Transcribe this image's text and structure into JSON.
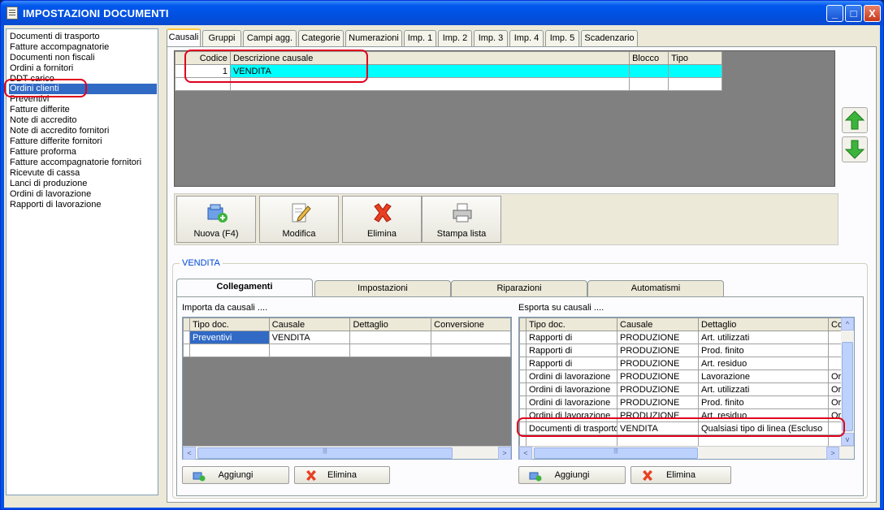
{
  "window": {
    "title": "IMPOSTAZIONI DOCUMENTI",
    "min": "_",
    "max": "□",
    "close": "X"
  },
  "doc_types": [
    "Documenti di trasporto",
    "Fatture accompagnatorie",
    "Documenti non fiscali",
    "Ordini a fornitori",
    "DDT carico",
    "Ordini clienti",
    "Preventivi",
    "Fatture differite",
    "Note di accredito",
    "Note di accredito fornitori",
    "Fatture differite fornitori",
    "Fatture proforma",
    "Fatture accompagnatorie fornitori",
    "Ricevute di cassa",
    "Lanci di produzione",
    "Ordini di lavorazione",
    "Rapporti di lavorazione"
  ],
  "tabs": [
    "Causali",
    "Gruppi",
    "Campi agg.",
    "Categorie",
    "Numerazioni",
    "Imp. 1",
    "Imp. 2",
    "Imp. 3",
    "Imp. 4",
    "Imp. 5",
    "Scadenzario"
  ],
  "causali_grid": {
    "headers": [
      "Codice",
      "Descrizione causale",
      "Blocco",
      "Tipo"
    ],
    "rows": [
      [
        "1",
        "VENDITA",
        "",
        ""
      ]
    ]
  },
  "toolbar": {
    "new": "Nuova (F4)",
    "edit": "Modifica",
    "delete": "Elimina",
    "print": "Stampa lista"
  },
  "group_title": "VENDITA",
  "subtabs": [
    "Collegamenti",
    "Impostazioni",
    "Riparazioni",
    "Automatismi"
  ],
  "import": {
    "label": "Importa da causali ....",
    "headers": [
      "Tipo doc.",
      "Causale",
      "Dettaglio",
      "Conversione"
    ],
    "rows": [
      [
        "Preventivi",
        "VENDITA",
        "",
        ""
      ]
    ],
    "add": "Aggiungi",
    "delete": "Elimina"
  },
  "export": {
    "label": "Esporta su causali ....",
    "headers": [
      "Tipo doc.",
      "Causale",
      "Dettaglio",
      "Co"
    ],
    "rows": [
      [
        "Rapporti di",
        "PRODUZIONE",
        "Art. utilizzati",
        ""
      ],
      [
        "Rapporti di",
        "PRODUZIONE",
        "Prod. finito",
        ""
      ],
      [
        "Rapporti di",
        "PRODUZIONE",
        "Art. residuo",
        ""
      ],
      [
        "Ordini di lavorazione",
        "PRODUZIONE",
        "Lavorazione",
        "Or"
      ],
      [
        "Ordini di lavorazione",
        "PRODUZIONE",
        "Art. utilizzati",
        "Or"
      ],
      [
        "Ordini di lavorazione",
        "PRODUZIONE",
        "Prod. finito",
        "Or"
      ],
      [
        "Ordini di lavorazione",
        "PRODUZIONE",
        "Art. residuo",
        "Or"
      ],
      [
        "Documenti di trasporto",
        "VENDITA",
        "Qualsiasi tipo di linea (Escluso",
        ""
      ]
    ],
    "add": "Aggiungi",
    "delete": "Elimina"
  },
  "scroll": {
    "left": "<",
    "right": ">",
    "up": "^",
    "down": "v",
    "grip": "|||"
  }
}
